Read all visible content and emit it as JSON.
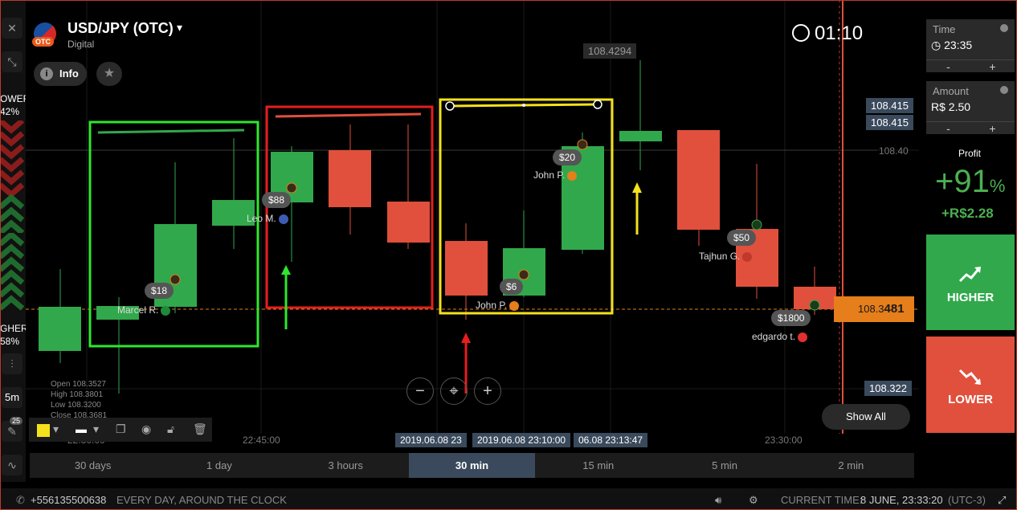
{
  "header": {
    "pair": "USD/JPY (OTC)",
    "caret": "▾",
    "type": "Digital",
    "otc_tag": "OTC",
    "info_label": "Info",
    "timer": "01:10"
  },
  "left": {
    "lower_lbl": "OWER",
    "lower_pct": "42%",
    "higher_lbl": "GHER",
    "higher_pct": "58%",
    "timeframe": "5m",
    "badge": "25"
  },
  "prices": {
    "top_badge": "108.4294",
    "badge_a": "108.415",
    "badge_b": "108.415",
    "line_label": "108.40",
    "current": "108.3",
    "current_bold": "481",
    "low_badge": "108.322"
  },
  "trades": [
    {
      "amount": "$18",
      "name": "Marcel R."
    },
    {
      "amount": "$88",
      "name": "Leo M."
    },
    {
      "amount": "$6",
      "name": "John P."
    },
    {
      "amount": "$20",
      "name": "John P."
    },
    {
      "amount": "$50",
      "name": "Tajhun G."
    },
    {
      "amount": "$1800",
      "name": "edgardo t."
    }
  ],
  "ohlc": {
    "open": "Open  108.3527",
    "high": "High   108.3801",
    "low": "Low   108.3200",
    "close": "Close 108.3681"
  },
  "times": {
    "t1": "22:30:00",
    "t2": "22:45:00",
    "t3": "23:30:00",
    "b1": "2019.06.08 23",
    "b2": "2019.06.08 23:10:00",
    "b3": "06.08 23:13:47"
  },
  "show_all": "Show All",
  "timeframes": [
    "30 days",
    "1 day",
    "3 hours",
    "30 min",
    "15 min",
    "5 min",
    "2 min"
  ],
  "right": {
    "time_label": "Time",
    "time_value": "23:35",
    "amount_label": "Amount",
    "amount_value": "R$ 2.50",
    "minus": "-",
    "plus": "+",
    "profit_label": "Profit",
    "profit_pct": "+91",
    "profit_pct_sign": "%",
    "profit_amount": "+R$2.28",
    "higher": "HIGHER",
    "lower": "LOWER"
  },
  "footer": {
    "phone": "+556135500638",
    "slogan": "EVERY DAY, AROUND THE CLOCK",
    "current_time_label": "CURRENT TIME:",
    "current_time": "8 JUNE, 23:33:20",
    "tz": "(UTC-3)"
  },
  "colors": {
    "green": "#31a84c",
    "red": "#e0503c",
    "orange": "#e57e1b",
    "yellow": "#f5e11c"
  }
}
